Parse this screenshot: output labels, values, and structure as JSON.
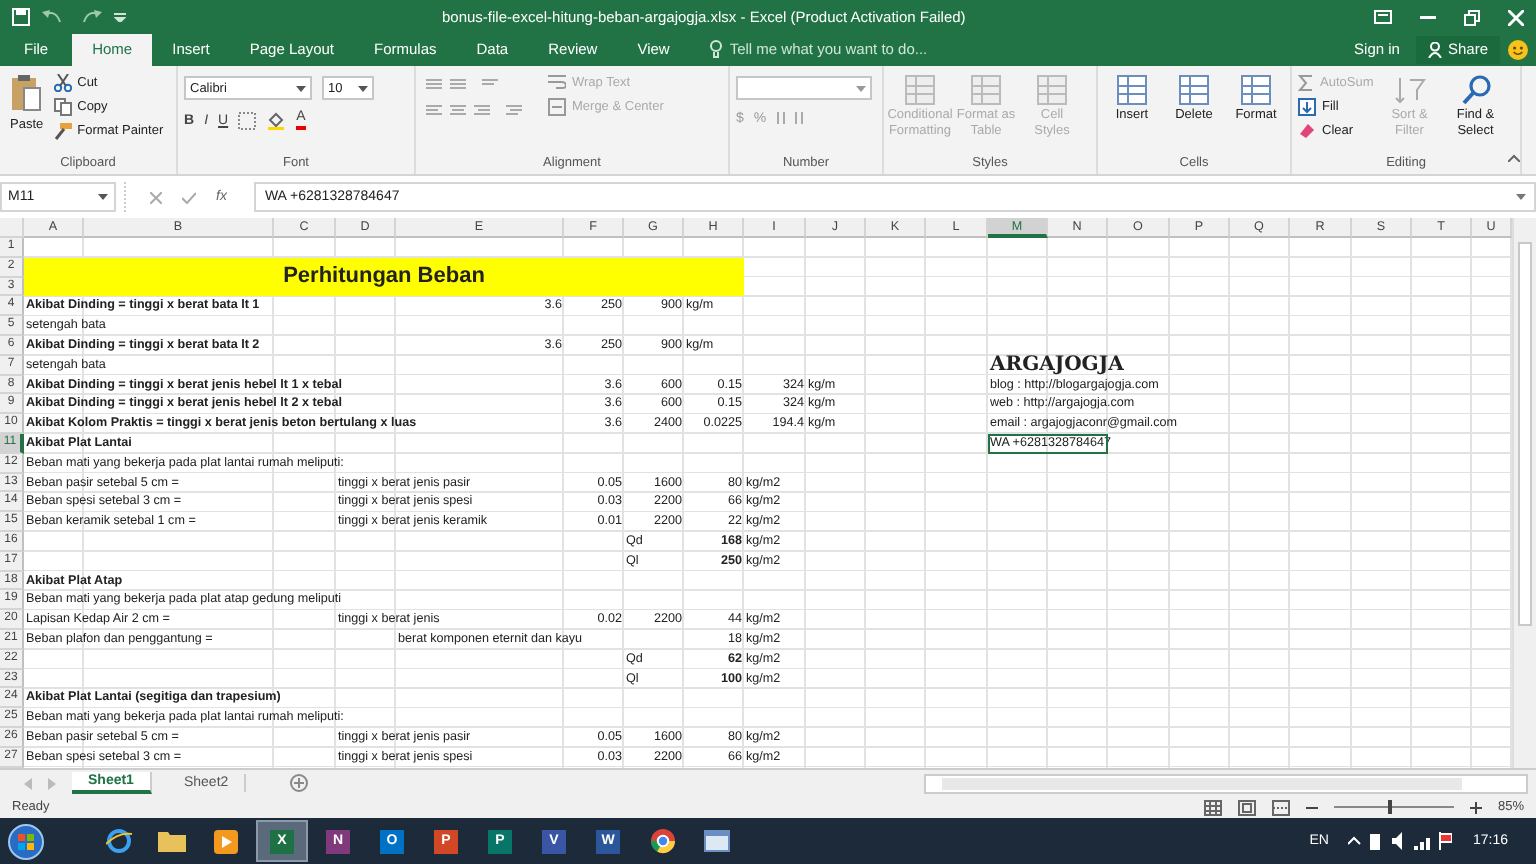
{
  "window": {
    "title": "bonus-file-excel-hitung-beban-argajogja.xlsx - Excel (Product Activation Failed)"
  },
  "tabs": [
    {
      "label": "File",
      "selected": false
    },
    {
      "label": "Home",
      "selected": true
    },
    {
      "label": "Insert",
      "selected": false
    },
    {
      "label": "Page Layout",
      "selected": false
    },
    {
      "label": "Formulas",
      "selected": false
    },
    {
      "label": "Data",
      "selected": false
    },
    {
      "label": "Review",
      "selected": false
    },
    {
      "label": "View",
      "selected": false
    }
  ],
  "tell_me": {
    "placeholder": "Tell me what you want to do..."
  },
  "account": {
    "sign_in": "Sign in",
    "share": "Share"
  },
  "ribbon": {
    "groups": [
      {
        "kind": "clipboard",
        "label": "Clipboard",
        "paste": "Paste",
        "items": [
          {
            "label": "Cut"
          },
          {
            "label": "Copy"
          },
          {
            "label": "Format Painter"
          }
        ]
      },
      {
        "kind": "font",
        "label": "Font",
        "font": "Calibri",
        "size": "10",
        "styles": [
          "B",
          "I",
          "U"
        ],
        "color_letter": "A"
      },
      {
        "kind": "alignment",
        "label": "Alignment",
        "items": [
          {
            "label": "Wrap Text",
            "disabled": true
          },
          {
            "label": "Merge & Center",
            "disabled": true
          }
        ]
      },
      {
        "kind": "number",
        "label": "Number",
        "symbols": [
          "$",
          "%"
        ]
      },
      {
        "kind": "large",
        "label": "Styles",
        "items": [
          {
            "label": "Conditional Formatting",
            "disabled": true
          },
          {
            "label": "Format as Table",
            "disabled": true
          },
          {
            "label": "Cell Styles",
            "disabled": true
          }
        ]
      },
      {
        "kind": "large",
        "label": "Cells",
        "items": [
          {
            "label": "Insert",
            "disabled": false
          },
          {
            "label": "Delete",
            "disabled": false
          },
          {
            "label": "Format",
            "disabled": false
          }
        ]
      },
      {
        "kind": "editing",
        "label": "Editing",
        "items": [
          {
            "label": "AutoSum",
            "disabled": true
          },
          {
            "label": "Fill",
            "disabled": false
          },
          {
            "label": "Clear",
            "disabled": false
          }
        ],
        "large": [
          {
            "label": "Sort & Filter",
            "disabled": true
          },
          {
            "label": "Find & Select",
            "disabled": false
          }
        ]
      }
    ]
  },
  "formula_bar": {
    "name_box": "M11",
    "fx": "fx",
    "value": "WA +6281328784647"
  },
  "sheet": {
    "columns": [
      {
        "label": "A",
        "selected": false
      },
      {
        "label": "B",
        "selected": false
      },
      {
        "label": "C",
        "selected": false
      },
      {
        "label": "D",
        "selected": false
      },
      {
        "label": "E",
        "selected": false
      },
      {
        "label": "F",
        "selected": false
      },
      {
        "label": "G",
        "selected": false
      },
      {
        "label": "H",
        "selected": false
      },
      {
        "label": "I",
        "selected": false
      },
      {
        "label": "J",
        "selected": false
      },
      {
        "label": "K",
        "selected": false
      },
      {
        "label": "L",
        "selected": false
      },
      {
        "label": "M",
        "selected": true
      },
      {
        "label": "N",
        "selected": false
      },
      {
        "label": "O",
        "selected": false
      },
      {
        "label": "P",
        "selected": false
      },
      {
        "label": "Q",
        "selected": false
      },
      {
        "label": "R",
        "selected": false
      },
      {
        "label": "S",
        "selected": false
      },
      {
        "label": "T",
        "selected": false
      },
      {
        "label": "U",
        "selected": false
      }
    ],
    "rows": [
      {
        "label": "1",
        "selected": false,
        "cells": {}
      },
      {
        "label": "2",
        "selected": false,
        "cells": {
          "A": {
            "kind": "banner",
            "text": "Perhitungan Beban",
            "selected": false
          }
        }
      },
      {
        "label": "3",
        "selected": false,
        "cells": {}
      },
      {
        "label": "4",
        "selected": false,
        "cells": {
          "A": {
            "kind": "heading",
            "text": "Akibat Dinding = tinggi x berat bata lt 1",
            "selected": false
          },
          "E": {
            "kind": "num",
            "text": "3.6",
            "selected": false
          },
          "F": {
            "kind": "num",
            "text": "250",
            "selected": false
          },
          "G": {
            "kind": "num",
            "text": "900",
            "selected": false
          },
          "H": {
            "kind": "text",
            "text": "kg/m",
            "selected": false
          }
        }
      },
      {
        "label": "5",
        "selected": false,
        "cells": {
          "A": {
            "kind": "text",
            "text": "setengah bata",
            "selected": false
          }
        }
      },
      {
        "label": "6",
        "selected": false,
        "cells": {
          "A": {
            "kind": "heading",
            "text": "Akibat Dinding = tinggi x berat bata lt 2",
            "selected": false
          },
          "E": {
            "kind": "num",
            "text": "3.6",
            "selected": false
          },
          "F": {
            "kind": "num",
            "text": "250",
            "selected": false
          },
          "G": {
            "kind": "num",
            "text": "900",
            "selected": false
          },
          "H": {
            "kind": "text",
            "text": "kg/m",
            "selected": false
          }
        }
      },
      {
        "label": "7",
        "selected": false,
        "cells": {
          "A": {
            "kind": "text",
            "text": "setengah bata",
            "selected": false
          },
          "M": {
            "kind": "logo",
            "text": "ARGAJOGJA",
            "selected": false
          }
        }
      },
      {
        "label": "8",
        "selected": false,
        "cells": {
          "A": {
            "kind": "heading",
            "text": "Akibat Dinding = tinggi x berat jenis hebel lt 1 x tebal",
            "selected": false
          },
          "F": {
            "kind": "num",
            "text": "3.6",
            "selected": false
          },
          "G": {
            "kind": "num",
            "text": "600",
            "selected": false
          },
          "H": {
            "kind": "num",
            "text": "0.15",
            "selected": false
          },
          "I": {
            "kind": "num",
            "text": "324",
            "selected": false
          },
          "J": {
            "kind": "text",
            "text": "kg/m",
            "selected": false
          },
          "M": {
            "kind": "text",
            "text": "blog : http://blogargajogja.com",
            "selected": false
          }
        }
      },
      {
        "label": "9",
        "selected": false,
        "cells": {
          "A": {
            "kind": "heading",
            "text": "Akibat Dinding = tinggi x berat jenis hebel lt 2 x tebal",
            "selected": false
          },
          "F": {
            "kind": "num",
            "text": "3.6",
            "selected": false
          },
          "G": {
            "kind": "num",
            "text": "600",
            "selected": false
          },
          "H": {
            "kind": "num",
            "text": "0.15",
            "selected": false
          },
          "I": {
            "kind": "num",
            "text": "324",
            "selected": false
          },
          "J": {
            "kind": "text",
            "text": "kg/m",
            "selected": false
          },
          "M": {
            "kind": "text",
            "text": "web : http://argajogja.com",
            "selected": false
          }
        }
      },
      {
        "label": "10",
        "selected": false,
        "cells": {
          "A": {
            "kind": "heading",
            "text": "Akibat Kolom Praktis = tinggi x berat jenis beton bertulang x luas",
            "selected": false
          },
          "F": {
            "kind": "num",
            "text": "3.6",
            "selected": false
          },
          "G": {
            "kind": "num",
            "text": "2400",
            "selected": false
          },
          "H": {
            "kind": "num",
            "text": "0.0225",
            "selected": false
          },
          "I": {
            "kind": "num",
            "text": "194.4",
            "selected": false
          },
          "J": {
            "kind": "text",
            "text": "kg/m",
            "selected": false
          },
          "M": {
            "kind": "text",
            "text": "email : argajogjaconr@gmail.com",
            "selected": false
          }
        }
      },
      {
        "label": "11",
        "selected": true,
        "cells": {
          "A": {
            "kind": "heading",
            "text": "Akibat Plat Lantai",
            "selected": false
          },
          "M": {
            "kind": "text",
            "text": "WA +6281328784647",
            "selected": true
          }
        }
      },
      {
        "label": "12",
        "selected": false,
        "cells": {
          "A": {
            "kind": "text",
            "text": "Beban mati yang bekerja pada plat lantai rumah meliputi:",
            "selected": false
          }
        }
      },
      {
        "label": "13",
        "selected": false,
        "cells": {
          "A": {
            "kind": "text",
            "text": "Beban pasir setebal 5 cm =",
            "selected": false
          },
          "D": {
            "kind": "text",
            "text": "tinggi x berat jenis pasir",
            "selected": false
          },
          "F": {
            "kind": "num",
            "text": "0.05",
            "selected": false
          },
          "G": {
            "kind": "num",
            "text": "1600",
            "selected": false
          },
          "H": {
            "kind": "num",
            "text": "80",
            "selected": false
          },
          "I": {
            "kind": "text",
            "text": "kg/m2",
            "selected": false
          }
        }
      },
      {
        "label": "14",
        "selected": false,
        "cells": {
          "A": {
            "kind": "text",
            "text": "Beban spesi setebal 3 cm =",
            "selected": false
          },
          "D": {
            "kind": "text",
            "text": "tinggi x berat jenis spesi",
            "selected": false
          },
          "F": {
            "kind": "num",
            "text": "0.03",
            "selected": false
          },
          "G": {
            "kind": "num",
            "text": "2200",
            "selected": false
          },
          "H": {
            "kind": "num",
            "text": "66",
            "selected": false
          },
          "I": {
            "kind": "text",
            "text": "kg/m2",
            "selected": false
          }
        }
      },
      {
        "label": "15",
        "selected": false,
        "cells": {
          "A": {
            "kind": "text",
            "text": "Beban keramik setebal 1 cm =",
            "selected": false
          },
          "D": {
            "kind": "text",
            "text": "tinggi x berat jenis keramik",
            "selected": false
          },
          "F": {
            "kind": "num",
            "text": "0.01",
            "selected": false
          },
          "G": {
            "kind": "num",
            "text": "2200",
            "selected": false
          },
          "H": {
            "kind": "num",
            "text": "22",
            "selected": false
          },
          "I": {
            "kind": "text",
            "text": "kg/m2",
            "selected": false
          }
        }
      },
      {
        "label": "16",
        "selected": false,
        "cells": {
          "G": {
            "kind": "text",
            "text": "Qd",
            "selected": false
          },
          "H": {
            "kind": "total",
            "text": "168",
            "selected": false
          },
          "I": {
            "kind": "text",
            "text": "kg/m2",
            "selected": false
          }
        }
      },
      {
        "label": "17",
        "selected": false,
        "cells": {
          "G": {
            "kind": "text",
            "text": "Ql",
            "selected": false
          },
          "H": {
            "kind": "total",
            "text": "250",
            "selected": false
          },
          "I": {
            "kind": "text",
            "text": "kg/m2",
            "selected": false
          }
        }
      },
      {
        "label": "18",
        "selected": false,
        "cells": {
          "A": {
            "kind": "heading",
            "text": "Akibat Plat Atap",
            "selected": false
          }
        }
      },
      {
        "label": "19",
        "selected": false,
        "cells": {
          "A": {
            "kind": "text",
            "text": "Beban mati yang bekerja pada plat atap gedung meliputi",
            "selected": false
          }
        }
      },
      {
        "label": "20",
        "selected": false,
        "cells": {
          "A": {
            "kind": "text",
            "text": "Lapisan Kedap Air 2 cm =",
            "selected": false
          },
          "D": {
            "kind": "text",
            "text": "tinggi x berat jenis",
            "selected": false
          },
          "F": {
            "kind": "num",
            "text": "0.02",
            "selected": false
          },
          "G": {
            "kind": "num",
            "text": "2200",
            "selected": false
          },
          "H": {
            "kind": "num",
            "text": "44",
            "selected": false
          },
          "I": {
            "kind": "text",
            "text": "kg/m2",
            "selected": false
          }
        }
      },
      {
        "label": "21",
        "selected": false,
        "cells": {
          "A": {
            "kind": "text",
            "text": "Beban plafon dan penggantung  =",
            "selected": false
          },
          "E": {
            "kind": "text",
            "text": "berat komponen eternit dan kayu",
            "selected": false
          },
          "H": {
            "kind": "num",
            "text": "18",
            "selected": false
          },
          "I": {
            "kind": "text",
            "text": "kg/m2",
            "selected": false
          }
        }
      },
      {
        "label": "22",
        "selected": false,
        "cells": {
          "G": {
            "kind": "text",
            "text": "Qd",
            "selected": false
          },
          "H": {
            "kind": "total",
            "text": "62",
            "selected": false
          },
          "I": {
            "kind": "text",
            "text": "kg/m2",
            "selected": false
          }
        }
      },
      {
        "label": "23",
        "selected": false,
        "cells": {
          "G": {
            "kind": "text",
            "text": "Ql",
            "selected": false
          },
          "H": {
            "kind": "total",
            "text": "100",
            "selected": false
          },
          "I": {
            "kind": "text",
            "text": "kg/m2",
            "selected": false
          }
        }
      },
      {
        "label": "24",
        "selected": false,
        "cells": {
          "A": {
            "kind": "heading",
            "text": "Akibat Plat Lantai (segitiga dan trapesium)",
            "selected": false
          }
        }
      },
      {
        "label": "25",
        "selected": false,
        "cells": {
          "A": {
            "kind": "text",
            "text": "Beban mati yang bekerja pada plat lantai rumah meliputi:",
            "selected": false
          }
        }
      },
      {
        "label": "26",
        "selected": false,
        "cells": {
          "A": {
            "kind": "text",
            "text": "Beban pasir setebal 5 cm =",
            "selected": false
          },
          "D": {
            "kind": "text",
            "text": "tinggi x berat jenis pasir",
            "selected": false
          },
          "F": {
            "kind": "num",
            "text": "0.05",
            "selected": false
          },
          "G": {
            "kind": "num",
            "text": "1600",
            "selected": false
          },
          "H": {
            "kind": "num",
            "text": "80",
            "selected": false
          },
          "I": {
            "kind": "text",
            "text": "kg/m2",
            "selected": false
          }
        }
      },
      {
        "label": "27",
        "selected": false,
        "cells": {
          "A": {
            "kind": "text",
            "text": "Beban spesi setebal 3 cm =",
            "selected": false
          },
          "D": {
            "kind": "text",
            "text": "tinggi x berat jenis spesi",
            "selected": false
          },
          "F": {
            "kind": "num",
            "text": "0.03",
            "selected": false
          },
          "G": {
            "kind": "num",
            "text": "2200",
            "selected": false
          },
          "H": {
            "kind": "num",
            "text": "66",
            "selected": false
          },
          "I": {
            "kind": "text",
            "text": "kg/m2",
            "selected": false
          }
        }
      }
    ]
  },
  "sheet_tabs": [
    {
      "label": "Sheet1",
      "selected": true
    },
    {
      "label": "Sheet2",
      "selected": false
    }
  ],
  "status_bar": {
    "text": "Ready",
    "zoom": {
      "level": 0.45,
      "reading": "85%"
    }
  },
  "taskbar": {
    "apps": [
      {
        "kind": "browser",
        "selected": false
      },
      {
        "kind": "folder",
        "selected": false
      },
      {
        "kind": "media",
        "selected": false
      },
      {
        "kind": "tile",
        "letter": "X",
        "color": "#1e7145",
        "selected": true
      },
      {
        "kind": "tile",
        "letter": "N",
        "color": "#80397b",
        "selected": false
      },
      {
        "kind": "tile",
        "letter": "O",
        "color": "#0072c6",
        "selected": false
      },
      {
        "kind": "tile",
        "letter": "P",
        "color": "#d24726",
        "selected": false
      },
      {
        "kind": "tile",
        "letter": "P",
        "color": "#077568",
        "selected": false
      },
      {
        "kind": "tile",
        "letter": "V",
        "color": "#3955a3",
        "selected": false
      },
      {
        "kind": "tile",
        "letter": "W",
        "color": "#2b579a",
        "selected": false
      },
      {
        "kind": "chrome",
        "selected": false
      },
      {
        "kind": "window",
        "selected": false
      }
    ],
    "language": "EN",
    "time": "17:16"
  }
}
